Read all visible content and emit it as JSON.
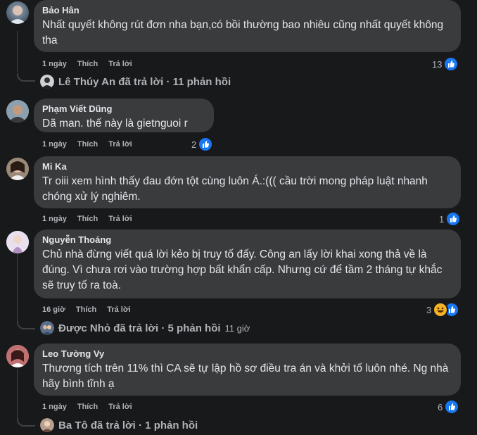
{
  "comments": [
    {
      "author": "Bảo Hân",
      "text": "Nhất quyết không rút đơn nha bạn,có bồi thường bao nhiêu cũng nhất quyết không tha",
      "time": "1 ngày",
      "like_label": "Thích",
      "reply_label": "Trả lời",
      "reaction_count": "13",
      "reply_summary": {
        "text": "Lê Thúy An đã trả lời · 11 phản hồi",
        "time": ""
      }
    },
    {
      "author": "Phạm Viết Dũng",
      "text": "Dã man. thế này là gietnguoi r",
      "time": "1 ngày",
      "like_label": "Thích",
      "reply_label": "Trả lời",
      "reaction_count": "2"
    },
    {
      "author": "Mi Ka",
      "text": "Tr oiii xem hình thấy đau đớn tột cùng luôn Á.:((( cầu trời mong pháp luật nhanh chóng xử lý nghiêm.",
      "time": "1 ngày",
      "like_label": "Thích",
      "reply_label": "Trả lời",
      "reaction_count": "1"
    },
    {
      "author": "Nguyễn Thoáng",
      "text": "Chủ nhà đừng viết quá lời kẻo bị truy tố đấy. Công an lấy lời khai xong thả về là đúng. Vì chưa rơi vào trường hợp bất khẩn cấp. Nhưng cứ để tầm 2 tháng tự khắc sẽ truy tố ra toà.",
      "time": "16 giờ",
      "like_label": "Thích",
      "reply_label": "Trả lời",
      "reaction_count": "3",
      "reply_summary": {
        "text": "Được Nhỏ đã trả lời · 5 phản hồi",
        "time": "11 giờ"
      }
    },
    {
      "author": "Leo Tường Vy",
      "text": "Thương tích trên 11% thì CA sẽ tự lập hồ sơ điều tra án và khởi tố luôn nhé. Ng nhà hãy bình tĩnh ạ",
      "time": "1 ngày",
      "like_label": "Thích",
      "reply_label": "Trả lời",
      "reaction_count": "6",
      "reply_summary": {
        "text": "Ba Tô đã trả lời · 1 phản hồi",
        "time": ""
      }
    }
  ],
  "colors": {
    "background": "#18191a",
    "bubble": "#3a3b3c",
    "like": "#1877f2",
    "haha": "#f7b125",
    "muted": "#b0b3b8"
  },
  "icons": {
    "like": "like-icon",
    "haha": "haha-icon"
  }
}
